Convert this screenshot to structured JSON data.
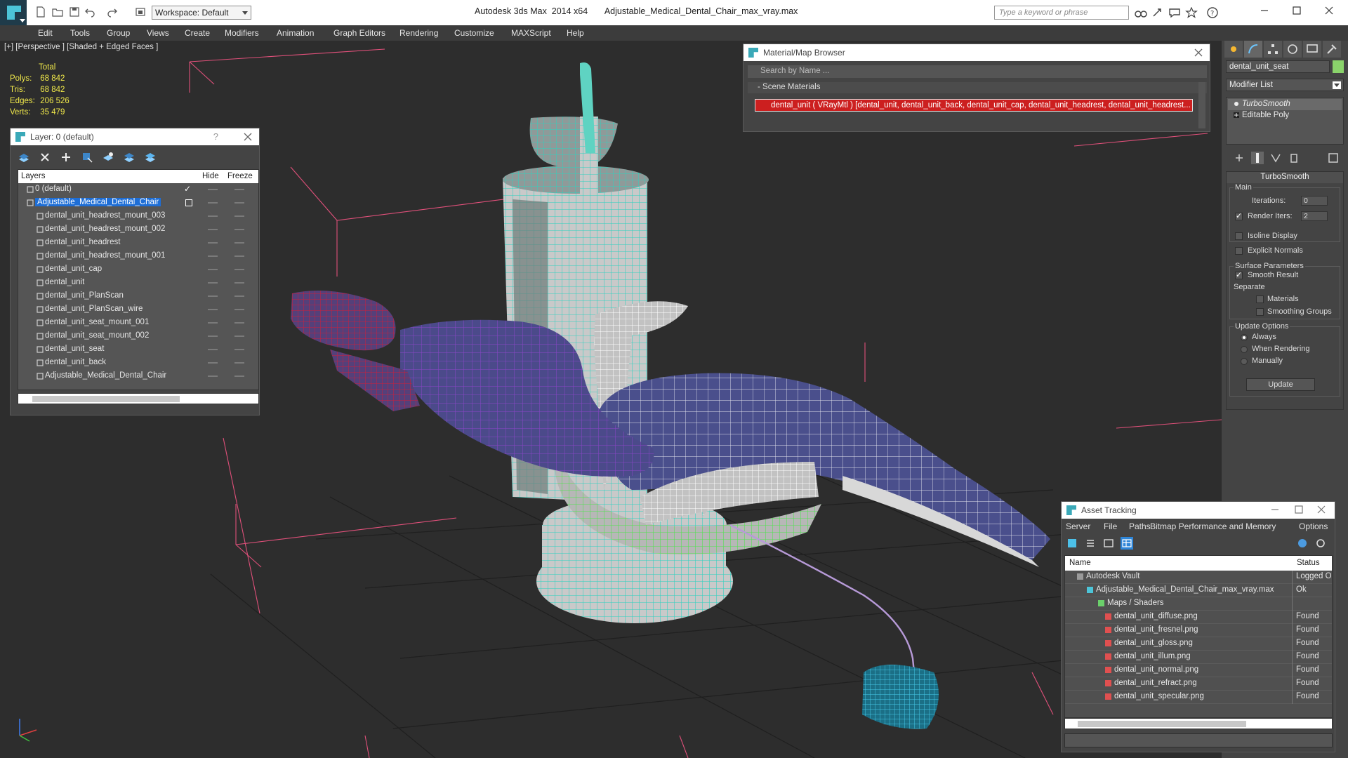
{
  "app": {
    "window_title": "Autodesk 3ds Max  2014 x64       Adjustable_Medical_Dental_Chair_max_vray.max",
    "workspace_label": "Workspace: Default",
    "search_placeholder": "Type a keyword or phrase"
  },
  "menu": [
    "Edit",
    "Tools",
    "Group",
    "Views",
    "Create",
    "Modifiers",
    "Animation",
    "Graph Editors",
    "Rendering",
    "Customize",
    "MAXScript",
    "Help"
  ],
  "viewport": {
    "label": "[+] [Perspective ] [Shaded + Edged Faces ]",
    "stats_header": "Total",
    "stats": [
      {
        "key": "Polys:",
        "value": "68 842"
      },
      {
        "key": "Tris:",
        "value": "68 842"
      },
      {
        "key": "Edges:",
        "value": "206 526"
      },
      {
        "key": "Verts:",
        "value": "35 479"
      }
    ]
  },
  "layer_dialog": {
    "title": "Layer: 0 (default)",
    "help": "?",
    "columns": {
      "layers": "Layers",
      "hide": "Hide",
      "freeze": "Freeze"
    },
    "rows": [
      {
        "name": "0 (default)",
        "level": 0
      },
      {
        "name": "Adjustable_Medical_Dental_Chair",
        "level": 0
      },
      {
        "name": "dental_unit_headrest_mount_003",
        "level": 1
      },
      {
        "name": "dental_unit_headrest_mount_002",
        "level": 1
      },
      {
        "name": "dental_unit_headrest",
        "level": 1
      },
      {
        "name": "dental_unit_headrest_mount_001",
        "level": 1
      },
      {
        "name": "dental_unit_cap",
        "level": 1
      },
      {
        "name": "dental_unit",
        "level": 1
      },
      {
        "name": "dental_unit_PlanScan",
        "level": 1
      },
      {
        "name": "dental_unit_PlanScan_wire",
        "level": 1
      },
      {
        "name": "dental_unit_seat_mount_001",
        "level": 1
      },
      {
        "name": "dental_unit_seat_mount_002",
        "level": 1
      },
      {
        "name": "dental_unit_seat",
        "level": 1
      },
      {
        "name": "dental_unit_back",
        "level": 1
      },
      {
        "name": "Adjustable_Medical_Dental_Chair",
        "level": 1
      }
    ]
  },
  "material_browser": {
    "title": "Material/Map Browser",
    "search_placeholder": "Search by Name ...",
    "section": "- Scene Materials",
    "material_entry": "dental_unit  ( VRayMtl ) [dental_unit, dental_unit_back, dental_unit_cap, dental_unit_headrest, dental_unit_headrest..."
  },
  "command_panel": {
    "object_name": "dental_unit_seat",
    "object_color": "#8ad36b",
    "modifier_list_label": "Modifier List",
    "stack": [
      "TurboSmooth",
      "Editable Poly"
    ],
    "rollout_title": "TurboSmooth",
    "main_label": "Main",
    "iterations_label": "Iterations:",
    "iterations_value": "0",
    "render_iters_label": "Render Iters:",
    "render_iters_value": "2",
    "isoline_label": "Isoline Display",
    "explicit_normals_label": "Explicit Normals",
    "surface_params_label": "Surface Parameters",
    "smooth_result_label": "Smooth Result",
    "separate_label": "Separate",
    "materials_label": "Materials",
    "smoothing_groups_label": "Smoothing Groups",
    "update_options_label": "Update Options",
    "always_label": "Always",
    "when_rendering_label": "When Rendering",
    "manually_label": "Manually",
    "update_button": "Update"
  },
  "asset_tracking": {
    "title": "Asset Tracking",
    "menu": [
      "Server",
      "File",
      "Paths",
      "Bitmap Performance and Memory",
      "Options"
    ],
    "columns": {
      "name": "Name",
      "status": "Status"
    },
    "rows": [
      {
        "name": "Autodesk Vault",
        "status": "Logged O",
        "level": 0
      },
      {
        "name": "Adjustable_Medical_Dental_Chair_max_vray.max",
        "status": "Ok",
        "level": 1
      },
      {
        "name": "Maps / Shaders",
        "status": "",
        "level": 2
      },
      {
        "name": "dental_unit_diffuse.png",
        "status": "Found",
        "level": 3
      },
      {
        "name": "dental_unit_fresnel.png",
        "status": "Found",
        "level": 3
      },
      {
        "name": "dental_unit_gloss.png",
        "status": "Found",
        "level": 3
      },
      {
        "name": "dental_unit_illum.png",
        "status": "Found",
        "level": 3
      },
      {
        "name": "dental_unit_normal.png",
        "status": "Found",
        "level": 3
      },
      {
        "name": "dental_unit_refract.png",
        "status": "Found",
        "level": 3
      },
      {
        "name": "dental_unit_specular.png",
        "status": "Found",
        "level": 3
      }
    ]
  },
  "colors": {
    "selection_blue": "#1e6ed6",
    "stats_yellow": "#f1e94a",
    "teal_wire": "#34d6c4",
    "seat_navy": "#4a4f8c",
    "purple_wire": "#8e45c9",
    "red_wire": "#d01e3a",
    "green_wire": "#4fe34f"
  }
}
